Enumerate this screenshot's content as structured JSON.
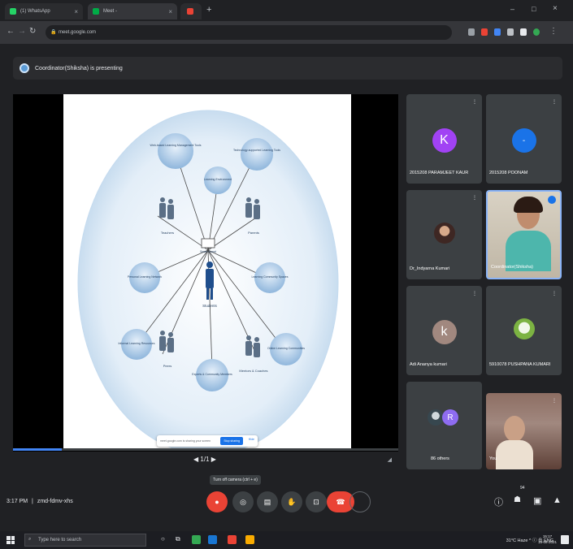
{
  "browser": {
    "tabs": [
      {
        "label": "(1) WhatsApp",
        "color": "#25d366"
      },
      {
        "label": "Meet - ",
        "color": "#00ac47"
      },
      {
        "label": "",
        "color": "#ea4335"
      }
    ],
    "url": "meet.google.com",
    "new_tab": "+",
    "window_controls": [
      "–",
      "□",
      "×"
    ]
  },
  "meet": {
    "presenting_text": "Coordinator(Shiksha) is presenting",
    "stage": {
      "pager": "◀ 1/1 ▶",
      "share_bar": {
        "text": "meet.google.com is sharing your screen",
        "stop_label": "Stop sharing",
        "hide_label": "Hide"
      }
    },
    "diagram": {
      "center_label": "Students",
      "screen_label": "Smart Board",
      "nodes": [
        {
          "label": "Web-based Learning Management Tools"
        },
        {
          "label": "Technology-supported Learning Tools"
        },
        {
          "label": "Learning Environment"
        },
        {
          "label": "Teachers"
        },
        {
          "label": "Parents"
        },
        {
          "label": "Personal Learning Network"
        },
        {
          "label": "Learning Community Spaces"
        },
        {
          "label": "Informal Learning Resources"
        },
        {
          "label": "Peers"
        },
        {
          "label": "Experts & Community Members"
        },
        {
          "label": "Mentors & Coaches"
        },
        {
          "label": "Online Learning Communities"
        }
      ]
    },
    "participants": [
      {
        "name": "2015208 PARAMJEET KAUR",
        "avatar_letter": "K",
        "avatar_color": "#a142f4",
        "type": "letter"
      },
      {
        "name": "2015208 POONAM",
        "avatar_letter": "-",
        "avatar_color": "#1a73e8",
        "type": "letter"
      },
      {
        "name": "Dr_Indyarna Kumari",
        "avatar_letter": "",
        "avatar_color": "#6d4c41",
        "type": "photo"
      },
      {
        "name": "Coordinator(Shiksha)",
        "avatar_letter": "",
        "avatar_color": "#c4a78b",
        "type": "video"
      },
      {
        "name": "Adi Ananya kumari",
        "avatar_letter": "k",
        "avatar_color": "#a1887f",
        "type": "letter"
      },
      {
        "name": "5910078 PUSHPANA KUMARI",
        "avatar_letter": "",
        "avatar_color": "#c5e1a5",
        "type": "photo"
      },
      {
        "name": "86 others",
        "avatar_letter": "R",
        "avatar_color": "#8e6cf1",
        "type": "others"
      },
      {
        "name": "You",
        "avatar_letter": "",
        "avatar_color": "#7a5c4d",
        "type": "video"
      }
    ],
    "controls": {
      "time": "3:17 PM",
      "separator": "|",
      "meeting_code": "zmd-fdmv-xhs",
      "tooltip": "Turn off camera (ctrl + e)",
      "buttons": [
        {
          "name": "mic",
          "glyph": "🎤"
        },
        {
          "name": "camera",
          "glyph": "◎"
        },
        {
          "name": "captions",
          "glyph": "▤"
        },
        {
          "name": "raise-hand",
          "glyph": "✋"
        },
        {
          "name": "present",
          "glyph": "⊡"
        },
        {
          "name": "more",
          "glyph": "⋮"
        },
        {
          "name": "leave",
          "glyph": "☎"
        },
        {
          "name": "extra",
          "glyph": ""
        }
      ],
      "right": [
        {
          "name": "info",
          "glyph": "ⓘ"
        },
        {
          "name": "people",
          "glyph": "👥",
          "badge": "94"
        },
        {
          "name": "chat",
          "glyph": "▣"
        },
        {
          "name": "activities",
          "glyph": "▲"
        }
      ]
    }
  },
  "taskbar": {
    "search_placeholder": "Type here to search",
    "tray_text": "31°C  Haze  ^  ⓘ  ⊕  ENG",
    "clock_time": "15:17",
    "clock_date": "18-08-2021"
  }
}
